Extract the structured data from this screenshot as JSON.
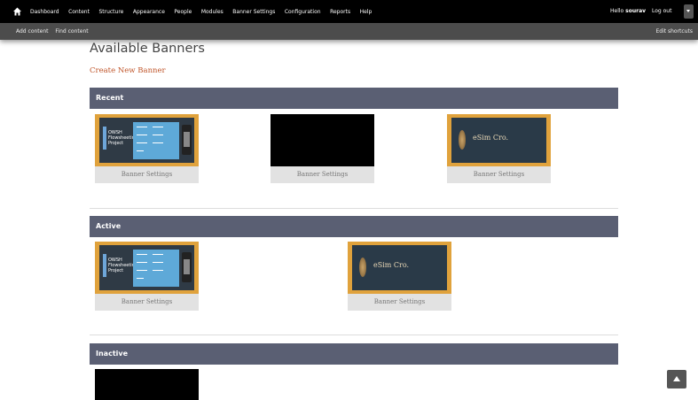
{
  "toolbar": {
    "nav": [
      "Dashboard",
      "Content",
      "Structure",
      "Appearance",
      "People",
      "Modules",
      "Banner Settings",
      "Configuration",
      "Reports",
      "Help"
    ],
    "hello_prefix": "Hello",
    "username": "sourav",
    "logout": "Log out"
  },
  "shortcuts": {
    "add_content": "Add content",
    "find_content": "Find content",
    "edit_shortcuts": "Edit shortcuts"
  },
  "page": {
    "title": "Available Banners",
    "create_link": "Create New Banner"
  },
  "sections": {
    "recent": "Recent",
    "active": "Active",
    "inactive": "Inactive"
  },
  "banner": {
    "settings_label": "Banner Settings",
    "project_title": "OWSH Flowsheeting Project",
    "esm_brand": "eSim Cro."
  },
  "colors": {
    "section_header": "#5a5f73",
    "thumb_border": "#e0a23c",
    "link": "#c0562b"
  }
}
